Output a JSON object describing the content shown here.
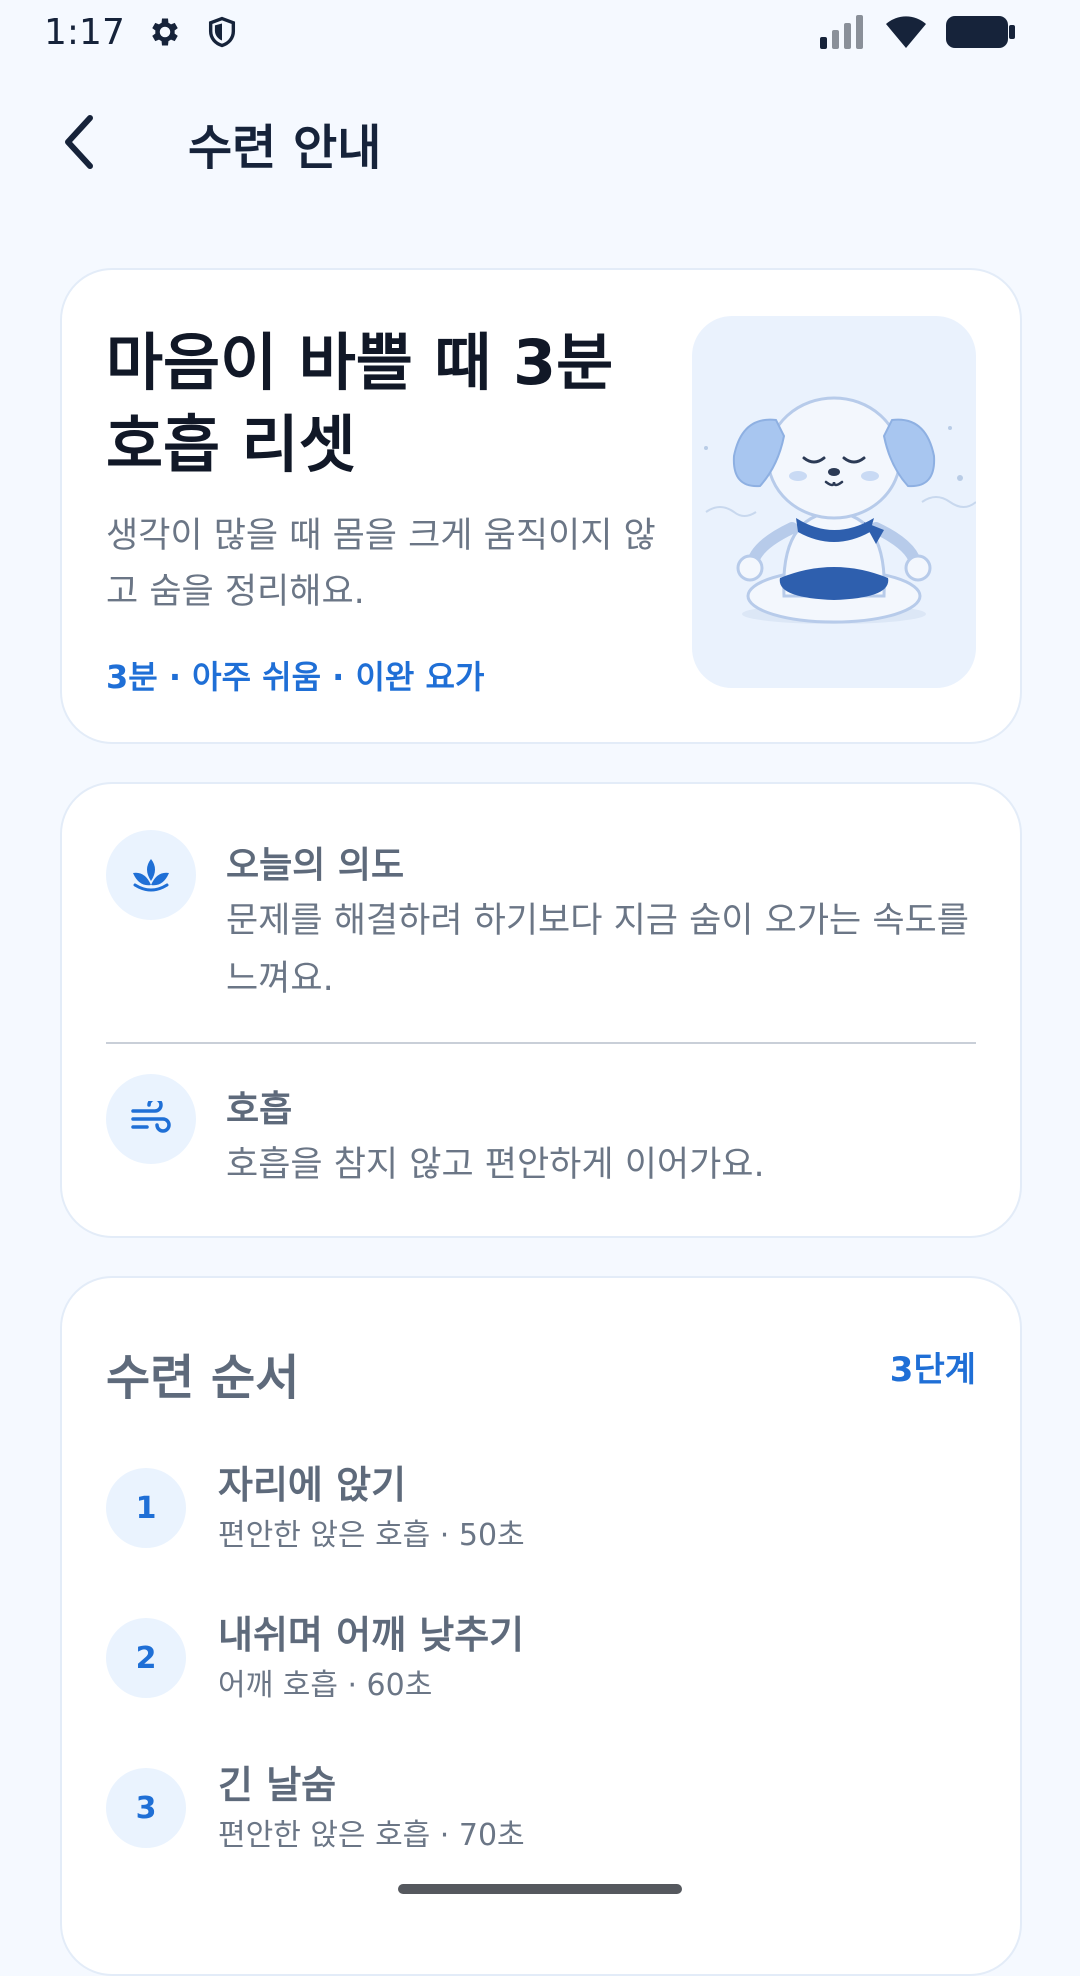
{
  "status_bar": {
    "time": "1:17",
    "icons": [
      "gear-icon",
      "shield-icon",
      "signal-icon",
      "wifi-icon",
      "battery-icon"
    ]
  },
  "header": {
    "title": "수련 안내",
    "back_icon": "chevron-left-icon"
  },
  "hero": {
    "title": "마음이 바쁠 때 3분 호흡 리셋",
    "description": "생각이 많을 때 몸을 크게 움직이지 않고 숨을 정리해요.",
    "meta": "3분 · 아주 쉬움 · 이완 요가",
    "illustration": "meditating-puppy-illustration"
  },
  "info": {
    "intention": {
      "icon": "lotus-icon",
      "title": "오늘의 의도",
      "text": "문제를 해결하려 하기보다 지금 숨이 오가는 속도를 느껴요."
    },
    "breathing": {
      "icon": "wind-icon",
      "title": "호흡",
      "text": "호흡을 참지 않고 편안하게 이어가요."
    }
  },
  "steps": {
    "title": "수련 순서",
    "count_label": "3단계",
    "items": [
      {
        "number": "1",
        "title": "자리에 앉기",
        "subtitle": "편안한 앉은 호흡 · 50초"
      },
      {
        "number": "2",
        "title": "내쉬며 어깨 낮추기",
        "subtitle": "어깨 호흡 · 60초"
      },
      {
        "number": "3",
        "title": "긴 날숨",
        "subtitle": "편안한 앉은 호흡 · 70초"
      }
    ]
  },
  "colors": {
    "accent": "#1F6FD6",
    "background": "#F5F9FF",
    "card": "#FFFFFF",
    "icon_bg": "#EAF3FE"
  }
}
